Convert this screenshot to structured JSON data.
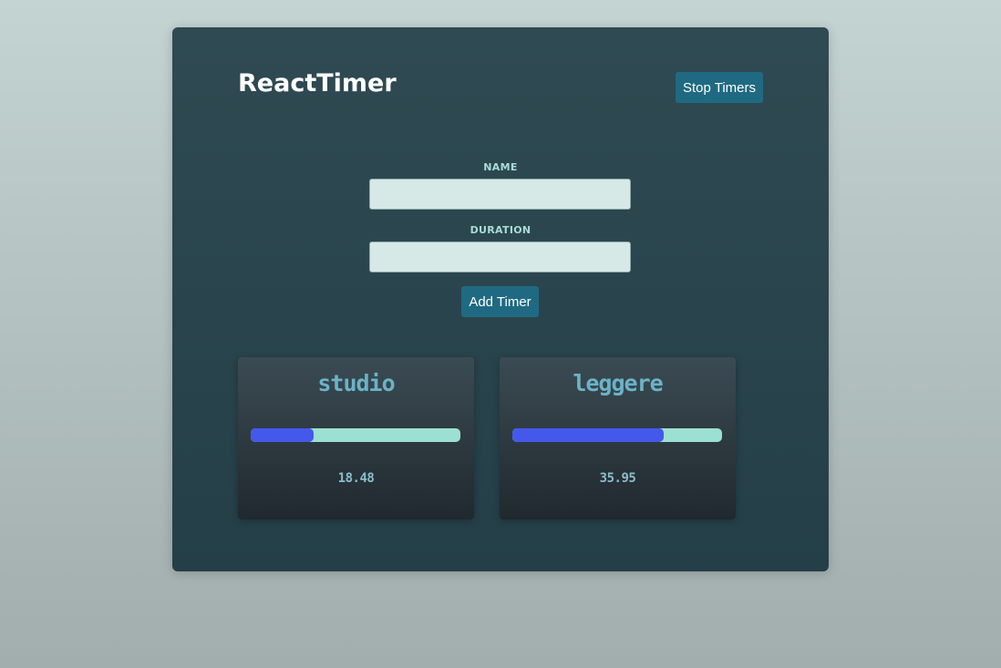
{
  "header": {
    "title": "ReactTimer",
    "stop_label": "Stop Timers"
  },
  "form": {
    "name_label": "NAME",
    "name_value": "",
    "duration_label": "DURATION",
    "duration_value": "",
    "add_label": "Add Timer"
  },
  "timers": [
    {
      "name": "studio",
      "remaining": "18.48",
      "progress": 0.3
    },
    {
      "name": "leggere",
      "remaining": "35.95",
      "progress": 0.72
    }
  ],
  "colors": {
    "page_bg_top": "#c3d4d2",
    "page_bg_bottom": "#a2adad",
    "panel": "#2c4951",
    "button": "#1f6a82",
    "progress_fill": "#4458ec",
    "progress_track": "#9be0d2",
    "timer_text": "#6bb3c7"
  }
}
